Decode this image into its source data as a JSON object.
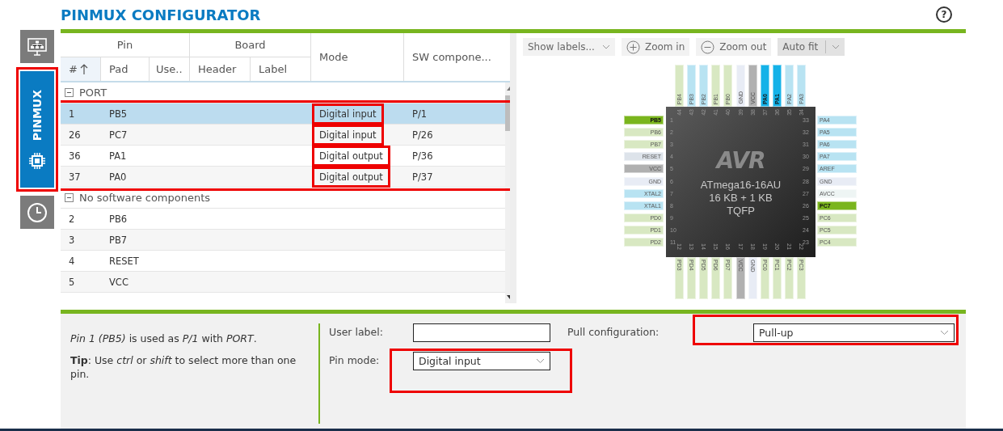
{
  "title": "PINMUX CONFIGURATOR",
  "help_icon": "?",
  "sidebar": {
    "items": [
      {
        "kind": "dashboard",
        "selected": false,
        "highlighted": false
      },
      {
        "kind": "pinmux",
        "label": "PINMUX",
        "selected": true,
        "highlighted": true
      },
      {
        "kind": "clock",
        "selected": false,
        "highlighted": false
      }
    ]
  },
  "table": {
    "header_groups": [
      {
        "label": "Pin"
      },
      {
        "label": "Board"
      }
    ],
    "columns": [
      {
        "label": "#",
        "sorted": true
      },
      {
        "label": "Pad",
        "sorted": false
      },
      {
        "label": "Use..",
        "sorted": false
      },
      {
        "label": "Header",
        "sorted": false
      },
      {
        "label": "Label",
        "sorted": false
      },
      {
        "label": "Mode",
        "sorted": false
      },
      {
        "label": "SW compone...",
        "sorted": false
      }
    ],
    "groups": [
      {
        "label": "PORT",
        "expanded": true,
        "highlighted": true,
        "rows": [
          {
            "number": "1",
            "pad": "PB5",
            "mode": "Digital input",
            "sw": "P/1",
            "selected": true,
            "mode_highlighted": true
          },
          {
            "number": "26",
            "pad": "PC7",
            "mode": "Digital input",
            "sw": "P/26",
            "selected": false,
            "mode_highlighted": true
          },
          {
            "number": "36",
            "pad": "PA1",
            "mode": "Digital output",
            "sw": "P/36",
            "selected": false,
            "mode_highlighted": true
          },
          {
            "number": "37",
            "pad": "PA0",
            "mode": "Digital output",
            "sw": "P/37",
            "selected": false,
            "mode_highlighted": true
          }
        ]
      },
      {
        "label": "No software components",
        "expanded": true,
        "highlighted": false,
        "rows": [
          {
            "number": "2",
            "pad": "PB6",
            "selected": false,
            "mode_highlighted": false
          },
          {
            "number": "3",
            "pad": "PB7",
            "selected": false,
            "mode_highlighted": false
          },
          {
            "number": "4",
            "pad": "RESET",
            "selected": false,
            "mode_highlighted": false
          },
          {
            "number": "5",
            "pad": "VCC",
            "selected": false,
            "mode_highlighted": false
          }
        ]
      }
    ]
  },
  "toolbar": [
    {
      "kind": "dropdown",
      "label": "Show labels...",
      "pressed": false
    },
    {
      "kind": "zoom_in",
      "label": "Zoom in",
      "pressed": false
    },
    {
      "kind": "zoom_out",
      "label": "Zoom out",
      "pressed": false
    },
    {
      "kind": "split",
      "label": "Auto fit",
      "pressed": true
    }
  ],
  "chip": {
    "logo": "AVR",
    "name": "ATmega16-16AU",
    "memory": "16 KB + 1 KB",
    "package": "TQFP",
    "pins": {
      "left": [
        {
          "number": "1",
          "label": "PB5",
          "color": "#7ab51d"
        },
        {
          "number": "2",
          "label": "PB6",
          "color": "#d8e8c2"
        },
        {
          "number": "3",
          "label": "PB7",
          "color": "#d8e8c2"
        },
        {
          "number": "4",
          "label": "RESET",
          "color": "#dde3ea"
        },
        {
          "number": "5",
          "label": "VCC",
          "color": "#b0b0b0"
        },
        {
          "number": "6",
          "label": "GND",
          "color": "#e8ecf5"
        },
        {
          "number": "7",
          "label": "XTAL2",
          "color": "#b8e3f2"
        },
        {
          "number": "8",
          "label": "XTAL1",
          "color": "#b8e3f2"
        },
        {
          "number": "9",
          "label": "PD0",
          "color": "#d8e8c2"
        },
        {
          "number": "10",
          "label": "PD1",
          "color": "#d8e8c2"
        },
        {
          "number": "11",
          "label": "PD2",
          "color": "#d8e8c2"
        }
      ],
      "bottom": [
        {
          "number": "12",
          "label": "PD3",
          "color": "#d8e8c2"
        },
        {
          "number": "13",
          "label": "PD4",
          "color": "#d8e8c2"
        },
        {
          "number": "14",
          "label": "PD5",
          "color": "#d8e8c2"
        },
        {
          "number": "15",
          "label": "PD6",
          "color": "#d8e8c2"
        },
        {
          "number": "16",
          "label": "PD7",
          "color": "#d8e8c2"
        },
        {
          "number": "17",
          "label": "VCC",
          "color": "#b0b0b0"
        },
        {
          "number": "18",
          "label": "GND",
          "color": "#e8ecf5"
        },
        {
          "number": "19",
          "label": "PC0",
          "color": "#d8e8c2"
        },
        {
          "number": "20",
          "label": "PC1",
          "color": "#d8e8c2"
        },
        {
          "number": "21",
          "label": "PC2",
          "color": "#d8e8c2"
        },
        {
          "number": "22",
          "label": "PC3",
          "color": "#d8e8c2"
        }
      ],
      "right": [
        {
          "number": "33",
          "label": "PA4",
          "color": "#b8e3f2"
        },
        {
          "number": "32",
          "label": "PA5",
          "color": "#b8e3f2"
        },
        {
          "number": "31",
          "label": "PA6",
          "color": "#b8e3f2"
        },
        {
          "number": "30",
          "label": "PA7",
          "color": "#b8e3f2"
        },
        {
          "number": "29",
          "label": "AREF",
          "color": "#b8e3f2"
        },
        {
          "number": "28",
          "label": "GND",
          "color": "#e8ecf5"
        },
        {
          "number": "27",
          "label": "AVCC",
          "color": "#eef5f4"
        },
        {
          "number": "26",
          "label": "PC7",
          "color": "#7ab51d"
        },
        {
          "number": "25",
          "label": "PC6",
          "color": "#d8e8c2"
        },
        {
          "number": "24",
          "label": "PC5",
          "color": "#d8e8c2"
        },
        {
          "number": "23",
          "label": "PC4",
          "color": "#d8e8c2"
        }
      ],
      "top": [
        {
          "number": "44",
          "label": "PB4",
          "color": "#d8e8c2"
        },
        {
          "number": "43",
          "label": "PB3",
          "color": "#b8e3f2"
        },
        {
          "number": "42",
          "label": "PB2",
          "color": "#b8e3f2"
        },
        {
          "number": "41",
          "label": "PB1",
          "color": "#d8e8c2"
        },
        {
          "number": "40",
          "label": "PB0",
          "color": "#d8e8c2"
        },
        {
          "number": "39",
          "label": "GND",
          "color": "#e8ecf5"
        },
        {
          "number": "38",
          "label": "VCC",
          "color": "#b0b0b0"
        },
        {
          "number": "37",
          "label": "PA0",
          "color": "#14b2e8"
        },
        {
          "number": "36",
          "label": "PA1",
          "color": "#14b2e8"
        },
        {
          "number": "35",
          "label": "PA2",
          "color": "#b8e3f2"
        },
        {
          "number": "34",
          "label": "PA3",
          "color": "#b8e3f2"
        }
      ]
    }
  },
  "details": {
    "paragraphs": [
      "*Pin 1 (PB5)* is used as *P/1* with *PORT*.",
      "**Tip**: Use *ctrl* or *shift* to select more than one pin."
    ],
    "user_label": {
      "label": "User label:"
    },
    "pin_mode": {
      "label": "Pin mode:",
      "value": "Digital input",
      "highlighted": true
    },
    "pull": {
      "label": "Pull configuration:",
      "value": "Pull-up",
      "highlighted": true
    }
  }
}
